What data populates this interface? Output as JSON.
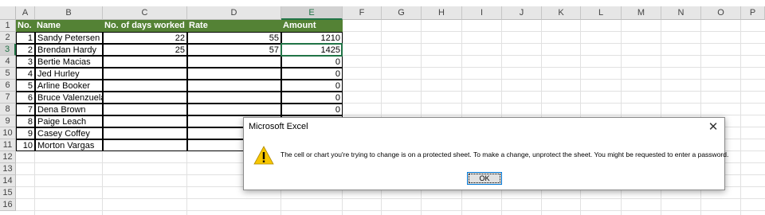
{
  "column_headers": [
    "A",
    "B",
    "C",
    "D",
    "E",
    "F",
    "G",
    "H",
    "I",
    "J",
    "K",
    "L",
    "M",
    "N",
    "O",
    "P"
  ],
  "row_headers": [
    "1",
    "2",
    "3",
    "4",
    "5",
    "6",
    "7",
    "8",
    "9",
    "10",
    "11",
    "12",
    "13",
    "14",
    "15",
    "16"
  ],
  "table": {
    "headers": [
      "No.",
      "Name",
      "No. of days worked",
      "Rate",
      "Amount"
    ],
    "rows": [
      {
        "no": "1",
        "name": "Sandy Petersen",
        "days": "22",
        "rate": "55",
        "amount": "1210"
      },
      {
        "no": "2",
        "name": "Brendan Hardy",
        "days": "25",
        "rate": "57",
        "amount": "1425"
      },
      {
        "no": "3",
        "name": "Bertie Macias",
        "days": "",
        "rate": "",
        "amount": "0"
      },
      {
        "no": "4",
        "name": "Jed Hurley",
        "days": "",
        "rate": "",
        "amount": "0"
      },
      {
        "no": "5",
        "name": "Arline Booker",
        "days": "",
        "rate": "",
        "amount": "0"
      },
      {
        "no": "6",
        "name": "Bruce Valenzuela",
        "days": "",
        "rate": "",
        "amount": "0"
      },
      {
        "no": "7",
        "name": "Dena Brown",
        "days": "",
        "rate": "",
        "amount": "0"
      },
      {
        "no": "8",
        "name": "Paige Leach",
        "days": "",
        "rate": "",
        "amount": ""
      },
      {
        "no": "9",
        "name": "Casey Coffey",
        "days": "",
        "rate": "",
        "amount": ""
      },
      {
        "no": "10",
        "name": "Morton Vargas",
        "days": "",
        "rate": "",
        "amount": ""
      }
    ]
  },
  "selected_cell": "E3",
  "colors": {
    "header_fill": "#548235",
    "selection": "#217346",
    "warning": "#f7c600"
  },
  "dialog": {
    "title": "Microsoft Excel",
    "message": "The cell or chart you're trying to change is on a protected sheet. To make a change, unprotect the sheet. You might be requested to enter a password.",
    "ok_label": "OK",
    "close_glyph": "✕",
    "icon": "warning-icon"
  }
}
